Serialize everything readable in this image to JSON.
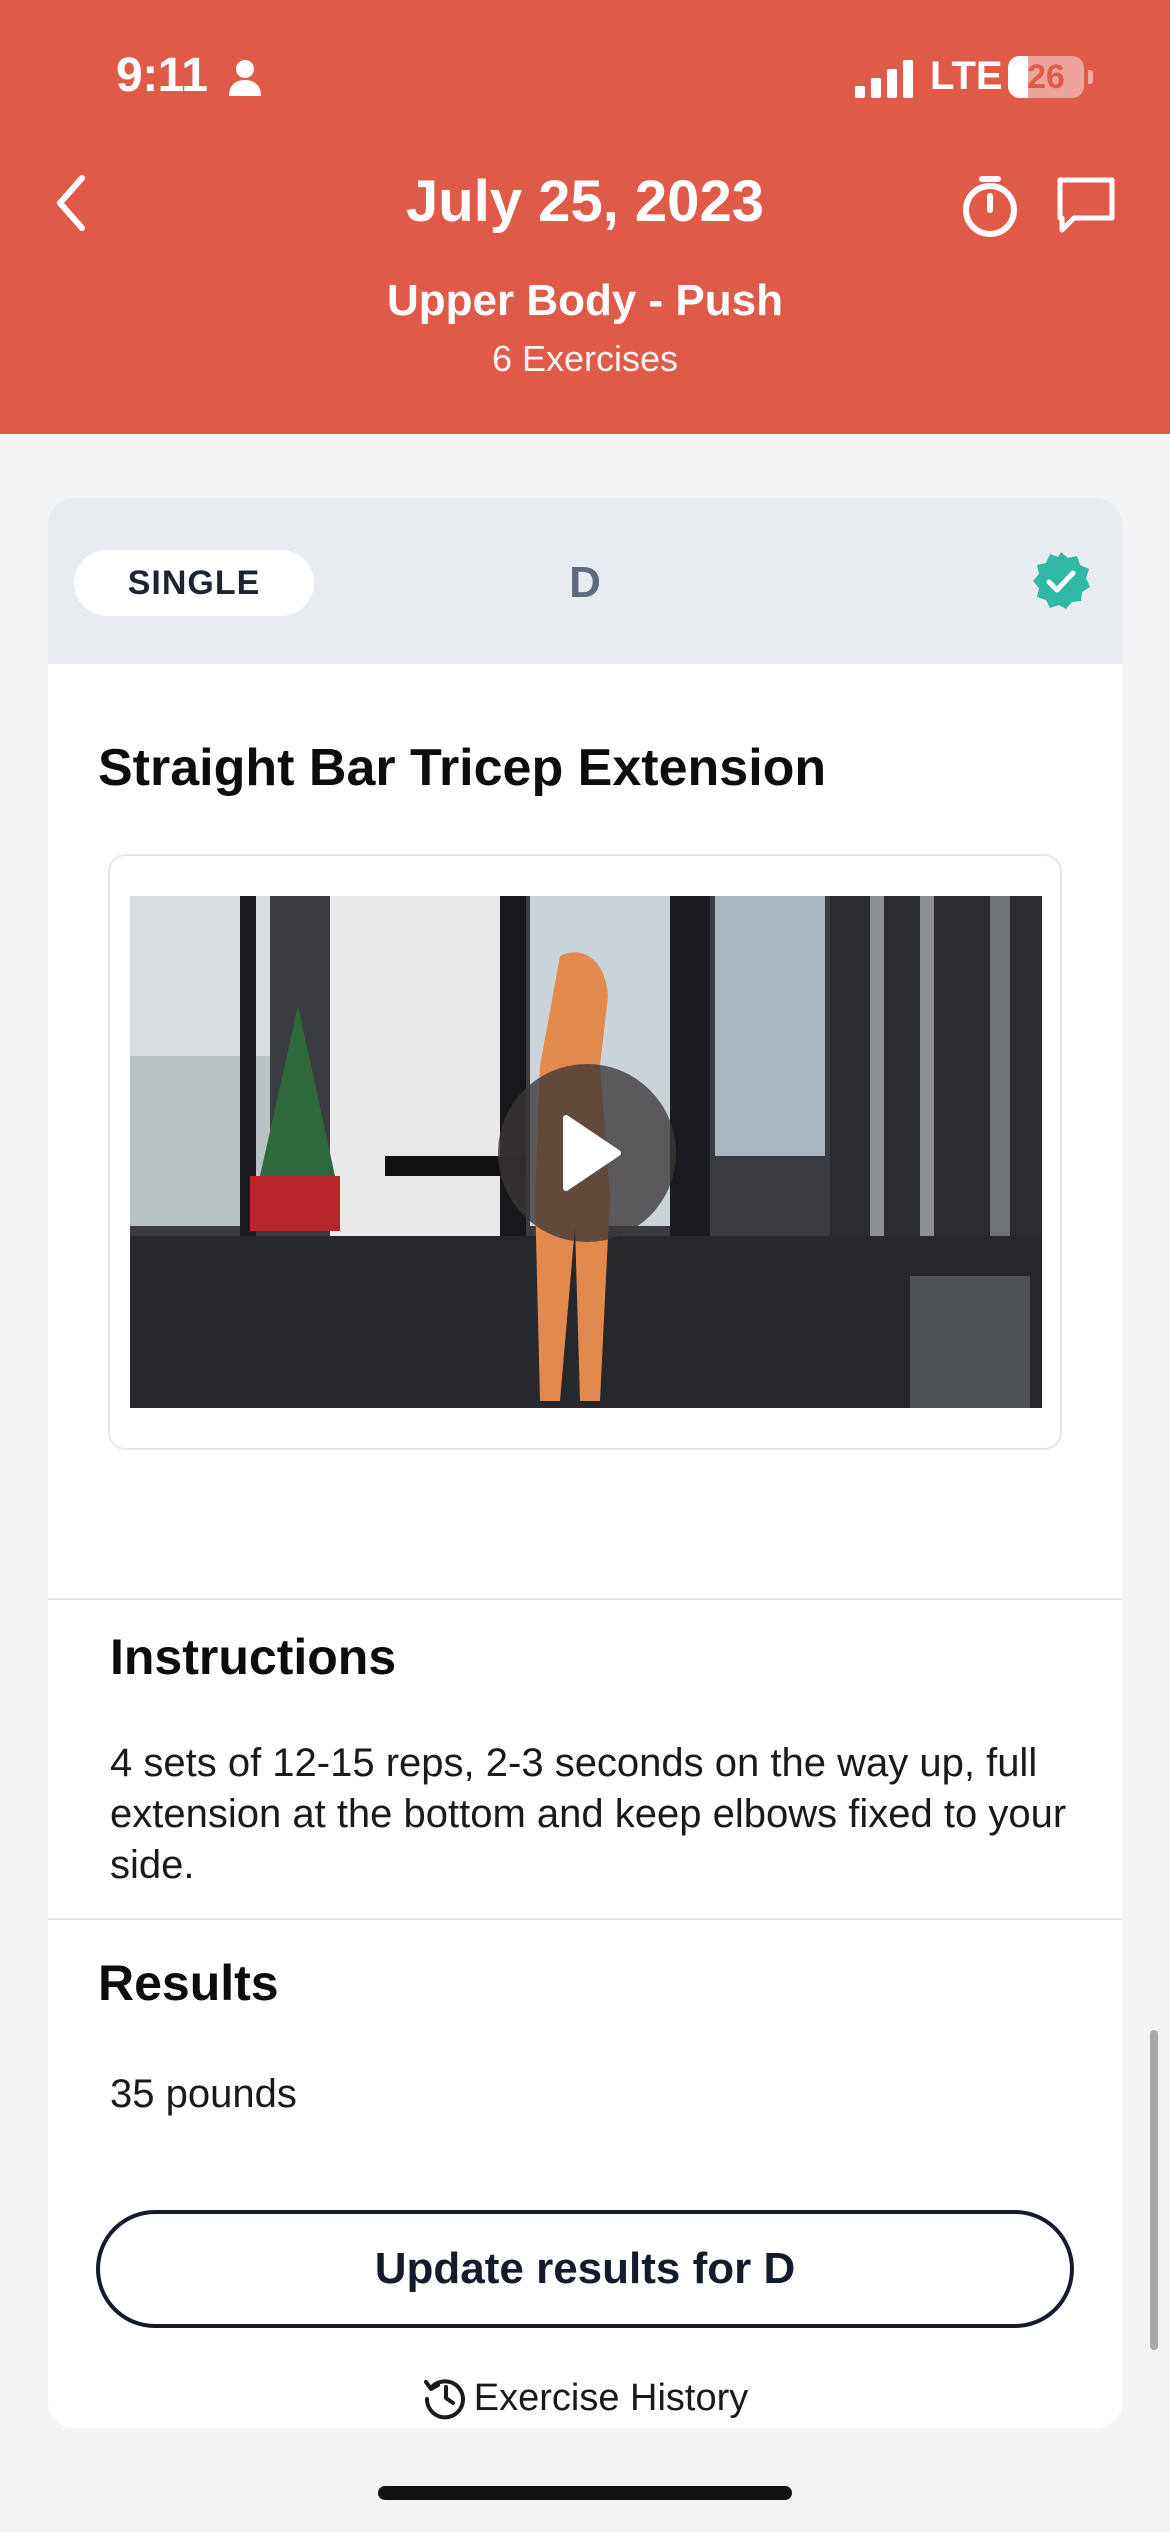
{
  "status_bar": {
    "time": "9:11",
    "network": "LTE",
    "battery": "26",
    "battery_level": 0.26,
    "person_icon": "person-icon",
    "signal_icon": "cell-signal-icon"
  },
  "header": {
    "title": "July 25, 2023",
    "workout_name": "Upper Body - Push",
    "exercise_count": "6 Exercises",
    "back_icon": "chevron-left-icon",
    "timer_icon": "stopwatch-icon",
    "chat_icon": "chat-bubble-icon",
    "bg_color": "#e05a4a"
  },
  "card": {
    "type_label": "SINGLE",
    "letter": "D",
    "verified_icon": "verified-check-icon",
    "verified_color": "#2fb8a6",
    "exercise_title": "Straight Bar Tricep Extension",
    "video": {
      "play_icon": "play-icon"
    },
    "instructions": {
      "heading": "Instructions",
      "text": "4 sets of 12-15 reps, 2-3 seconds on the way up, full extension at the bottom and keep elbows fixed to your side."
    },
    "results": {
      "heading": "Results",
      "value": "35 pounds",
      "update_button": "Update results for D",
      "history_link": "Exercise History",
      "history_icon": "history-clock-icon"
    }
  }
}
